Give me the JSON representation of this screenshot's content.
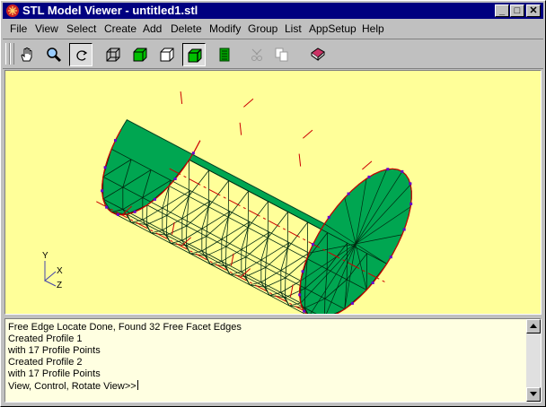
{
  "window": {
    "title": "STL Model Viewer - untitled1.stl",
    "controls": {
      "minimize": "_",
      "maximize": "□",
      "close": "✕"
    }
  },
  "menu": [
    "File",
    "View",
    "Select",
    "Create",
    "Add",
    "Delete",
    "Modify",
    "Group",
    "List",
    "AppSetup",
    "Help"
  ],
  "toolbar": {
    "tools": [
      {
        "name": "pan-hand-icon",
        "pressed": false
      },
      {
        "name": "zoom-magnifier-icon",
        "pressed": false
      },
      {
        "name": "rotate-icon",
        "pressed": true
      },
      {
        "name": "wireframe-cube-icon",
        "pressed": false
      },
      {
        "name": "shaded-cube-icon",
        "pressed": false
      },
      {
        "name": "hidden-line-cube-icon",
        "pressed": false
      },
      {
        "name": "shaded-edges-cube-icon",
        "pressed": true
      },
      {
        "name": "facet-list-icon",
        "pressed": false
      },
      {
        "name": "cut-icon",
        "pressed": false
      },
      {
        "name": "copy-icon",
        "pressed": false
      },
      {
        "name": "book-icon",
        "pressed": false
      }
    ]
  },
  "viewport": {
    "background": "#ffff99",
    "model_color": "#00a651",
    "edge_color": "#cc0000",
    "vertex_color": "#6600cc",
    "triad": {
      "y": "Y",
      "x": "X",
      "z": "Z"
    }
  },
  "console": {
    "lines": [
      "Free Edge Locate Done, Found 32 Free Facet Edges",
      "Created Profile 1",
      "with 17 Profile Points",
      "Created Profile 2",
      "with 17 Profile Points",
      "View, Control, Rotate View>>"
    ]
  }
}
